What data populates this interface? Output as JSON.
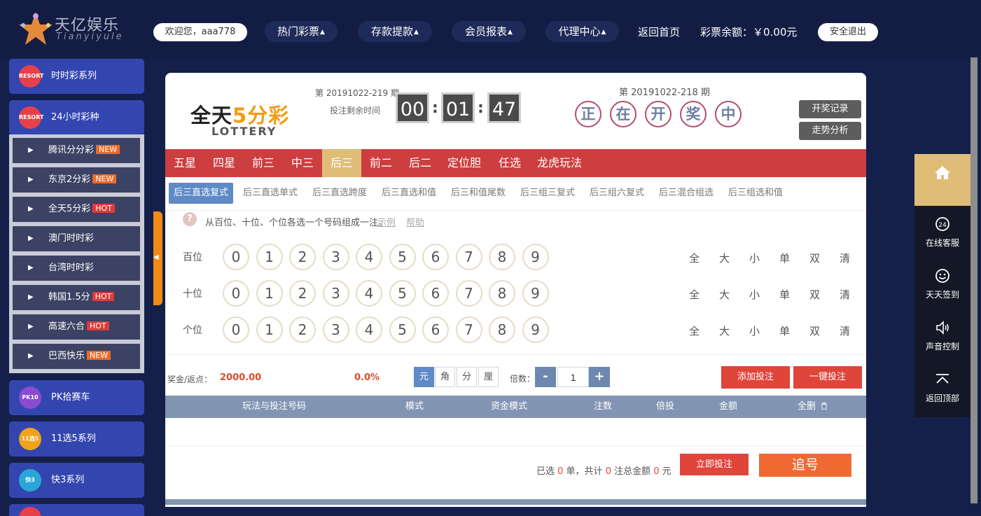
{
  "brand": {
    "name": "天亿娱乐",
    "sub": "Tianyiyule"
  },
  "header": {
    "welcome": "欢迎您，aaa778",
    "nav": [
      "热门彩票",
      "存款提款",
      "会员报表",
      "代理中心"
    ],
    "nav_arrow": "▲",
    "home": "返回首页",
    "balance": "彩票余额：￥0.00元",
    "logout": "安全退出"
  },
  "sidebar": {
    "categories": [
      {
        "label": "时时彩系列",
        "icon": "RESORT",
        "icon_name": "resort-logo-icon",
        "color": "#e8404a"
      },
      {
        "label": "24小时彩种",
        "icon": "RESORT",
        "icon_name": "resort-logo-icon",
        "color": "#e8404a"
      },
      {
        "label": "PK拾赛车",
        "icon": "PK10",
        "icon_name": "pk10-icon",
        "color": "#8a4bcf"
      },
      {
        "label": "11选5系列",
        "icon": "11选5",
        "icon_name": "11x5-icon",
        "color": "#f0a21a"
      },
      {
        "label": "快3系列",
        "icon": "快3",
        "icon_name": "k3-icon",
        "color": "#2aa7d8"
      }
    ],
    "subitems": [
      {
        "label": "腾讯分分彩",
        "tag": "NEW"
      },
      {
        "label": "东京2分彩",
        "tag": "NEW"
      },
      {
        "label": "全天5分彩",
        "tag": "HOT"
      },
      {
        "label": "澳门时时彩",
        "tag": ""
      },
      {
        "label": "台湾时时彩",
        "tag": ""
      },
      {
        "label": "韩国1.5分",
        "tag": "HOT"
      },
      {
        "label": "高速六合",
        "tag": "HOT"
      },
      {
        "label": "巴西快乐",
        "tag": "NEW"
      }
    ]
  },
  "game": {
    "title_a": "全天",
    "title_b": "5分彩",
    "subtitle": "LOTTERY",
    "current_period": "第 20191022-219 期",
    "countdown_label": "投注剩余时间",
    "countdown": [
      "00",
      "01",
      "47"
    ],
    "last_period": "第 20191022-218 期",
    "drawing": [
      "正",
      "在",
      "开",
      "奖",
      "中"
    ],
    "btn_history": "开奖记录",
    "btn_trend": "走势分析"
  },
  "tabs": {
    "items": [
      "五星",
      "四星",
      "前三",
      "中三",
      "后三",
      "前二",
      "后二",
      "定位胆",
      "任选",
      "龙虎玩法"
    ],
    "active": "后三"
  },
  "subtabs": {
    "items": [
      "后三直选复式",
      "后三直选单式",
      "后三直选跨度",
      "后三直选和值",
      "后三和值尾数",
      "后三组三复式",
      "后三组六复式",
      "后三混合组选",
      "后三组选和值"
    ],
    "active": "后三直选复式"
  },
  "tip": {
    "icon": "?",
    "text": "从百位、十位、个位各选一个号码组成一注。",
    "example": "示例",
    "help": "帮助"
  },
  "rows": [
    "百位",
    "十位",
    "个位"
  ],
  "digits": [
    "0",
    "1",
    "2",
    "3",
    "4",
    "5",
    "6",
    "7",
    "8",
    "9"
  ],
  "quick": [
    "全",
    "大",
    "小",
    "单",
    "双",
    "清"
  ],
  "bet": {
    "bonus_label": "奖金/返点：",
    "bonus": "2000.00",
    "rebate": "0.0%",
    "units": [
      "元",
      "角",
      "分",
      "厘"
    ],
    "unit_active": "元",
    "multiple_label": "倍数：",
    "minus": "-",
    "plus": "+",
    "multiple": "1",
    "add": "添加投注",
    "one_click": "一键投注"
  },
  "table": {
    "headers": [
      "玩法与投注号码",
      "模式",
      "资金模式",
      "注数",
      "倍投",
      "金额",
      "全删"
    ]
  },
  "summary": {
    "p1": "已选 ",
    "selected": "0",
    "p2": " 单，共计 ",
    "count": "0",
    "p3": " 注总金额 ",
    "amount": "0",
    "p4": " 元",
    "place": "立即投注",
    "chase": "追号"
  },
  "floatbar": {
    "items": [
      "在线客服",
      "天天签到",
      "声音控制",
      "返回顶部"
    ]
  },
  "colors": {
    "bg": "#14204a",
    "tab_red": "#cc3e3f",
    "tab_active": "#dfbd76",
    "accent_blue": "#5e8ac6",
    "btn_red": "#e0453a",
    "orange": "#f49a12"
  }
}
